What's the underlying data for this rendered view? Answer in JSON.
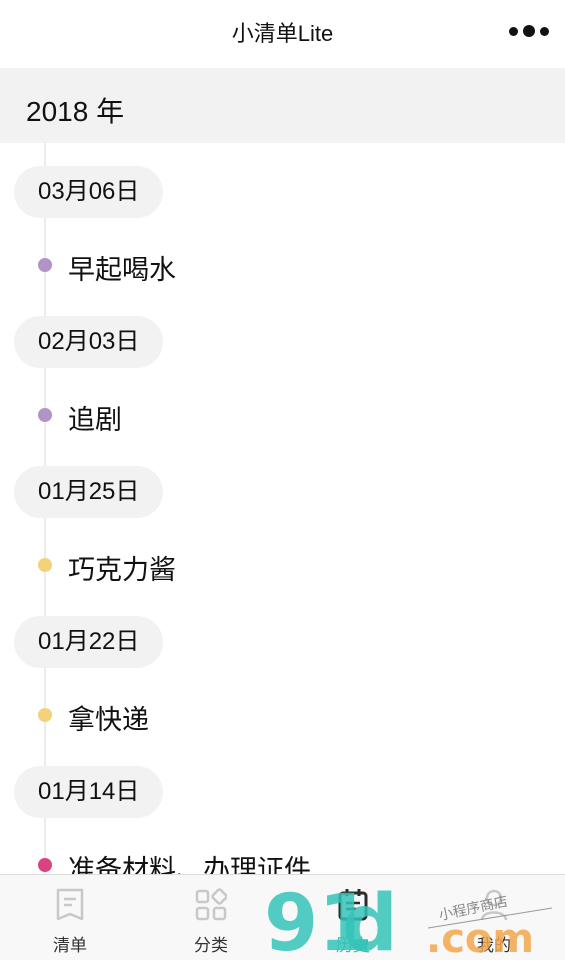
{
  "app": {
    "title": "小清单Lite"
  },
  "year_header": {
    "label": "2018 年"
  },
  "timeline": [
    {
      "date": "03月06日",
      "task": "早起喝水",
      "color": "#b193c6"
    },
    {
      "date": "02月03日",
      "task": "追剧",
      "color": "#b193c6"
    },
    {
      "date": "01月25日",
      "task": "巧克力酱",
      "color": "#f4d27a"
    },
    {
      "date": "01月22日",
      "task": "拿快递",
      "color": "#f4d27a"
    },
    {
      "date": "01月14日",
      "task": "准备材料、办理证件",
      "color": "#d9437e"
    }
  ],
  "tabbar": {
    "tabs": [
      {
        "label": "清单",
        "icon": "list-icon",
        "active": false
      },
      {
        "label": "分类",
        "icon": "category-icon",
        "active": false
      },
      {
        "label": "历史",
        "icon": "calendar-icon",
        "active": true
      },
      {
        "label": "我的",
        "icon": "user-icon",
        "active": false
      }
    ]
  },
  "watermark": {
    "brand": "91",
    "domain": ".com",
    "caption": "小程序商店"
  },
  "colors": {
    "accent": "#45b8b0",
    "pill_bg": "#f2f2f2",
    "header_bg": "#f2f2f2"
  }
}
